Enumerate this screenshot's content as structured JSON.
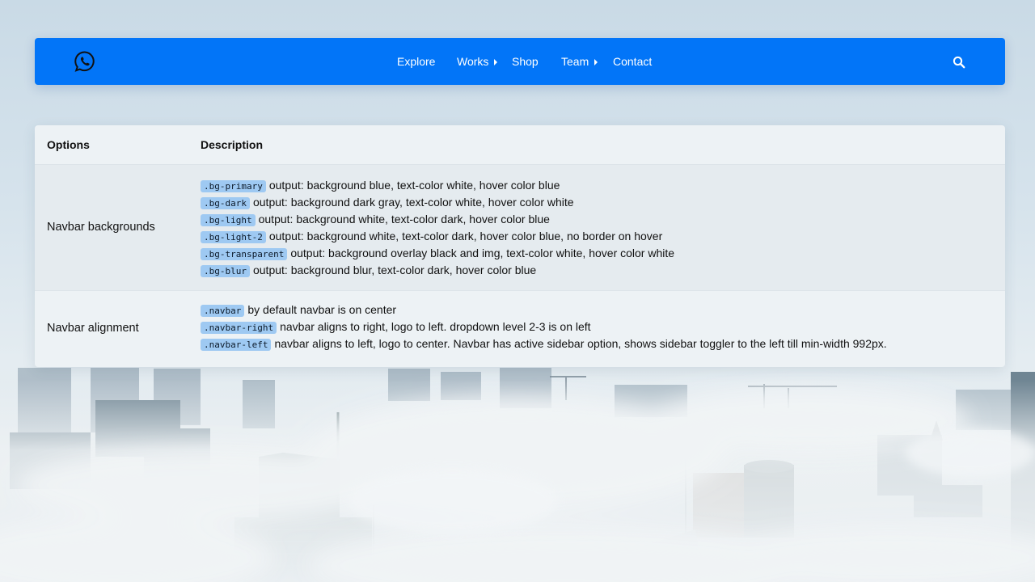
{
  "navbar": {
    "logo_icon": "whatsapp-icon",
    "background": "#0275f8",
    "items": [
      {
        "label": "Explore",
        "has_dropdown": false
      },
      {
        "label": "Works",
        "has_dropdown": true
      },
      {
        "label": "Shop",
        "has_dropdown": false
      },
      {
        "label": "Team",
        "has_dropdown": true
      },
      {
        "label": "Contact",
        "has_dropdown": false
      }
    ],
    "search_icon": "search-icon"
  },
  "table": {
    "headers": [
      "Options",
      "Description"
    ],
    "rows": [
      {
        "option": "Navbar backgrounds",
        "lines": [
          {
            "code": ".bg-primary",
            "text": "output: background blue, text-color white, hover color blue"
          },
          {
            "code": ".bg-dark",
            "text": "output: background dark gray, text-color white, hover color white"
          },
          {
            "code": ".bg-light",
            "text": "output: background white, text-color dark, hover color blue"
          },
          {
            "code": ".bg-light-2",
            "text": "output: background white, text-color dark, hover color blue, no border on hover"
          },
          {
            "code": ".bg-transparent",
            "text": "output: background overlay black and img, text-color white, hover color white"
          },
          {
            "code": ".bg-blur",
            "text": "output: background blur, text-color dark, hover color blue"
          }
        ]
      },
      {
        "option": "Navbar alignment",
        "lines": [
          {
            "code": ".navbar",
            "text": "by default navbar is on center"
          },
          {
            "code": ".navbar-right",
            "text": "navbar aligns to right, logo to left. dropdown level 2-3 is on left"
          },
          {
            "code": ".navbar-left",
            "text": "navbar aligns to left, logo to center. Navbar has active sidebar option, shows sidebar toggler to the left till min-width 992px."
          }
        ]
      }
    ]
  }
}
